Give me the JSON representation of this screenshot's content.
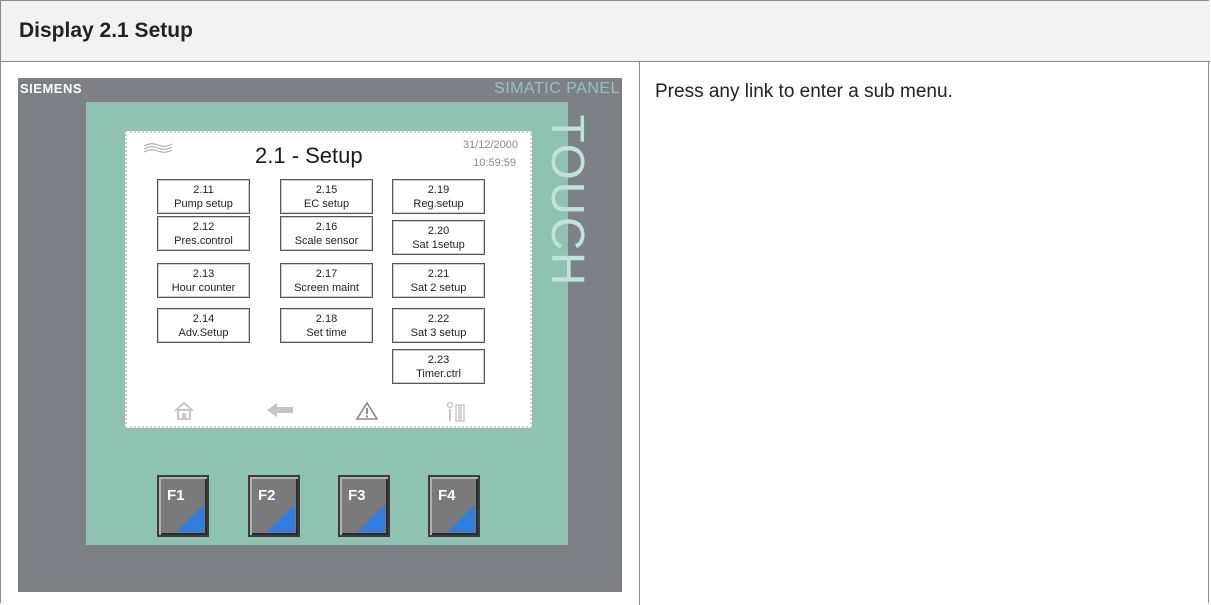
{
  "header": {
    "title": "Display 2.1 Setup"
  },
  "description": "Press any link to enter a sub menu.",
  "panel": {
    "brand": "SIEMENS",
    "model": "SIMATIC PANEL",
    "touch": "TOUCH",
    "screen": {
      "title": "2.1 - Setup",
      "date": "31/12/2000",
      "time": "10:59:59",
      "buttons": [
        {
          "num": "2.11",
          "label": "Pump setup"
        },
        {
          "num": "2.12",
          "label": "Pres.control"
        },
        {
          "num": "2.13",
          "label": "Hour counter"
        },
        {
          "num": "2.14",
          "label": "Adv.Setup"
        },
        {
          "num": "2.15",
          "label": "EC setup"
        },
        {
          "num": "2.16",
          "label": "Scale sensor"
        },
        {
          "num": "2.17",
          "label": "Screen maint"
        },
        {
          "num": "2.18",
          "label": "Set time"
        },
        {
          "num": "2.19",
          "label": "Reg.setup"
        },
        {
          "num": "2.20",
          "label": "Sat 1setup"
        },
        {
          "num": "2.21",
          "label": "Sat 2 setup"
        },
        {
          "num": "2.22",
          "label": "Sat 3 setup"
        },
        {
          "num": "2.23",
          "label": "Timer.ctrl"
        }
      ],
      "nav_icons": [
        "home-icon",
        "back-arrow-icon",
        "warning-icon",
        "settings-icon"
      ]
    },
    "function_keys": [
      "F1",
      "F2",
      "F3",
      "F4"
    ],
    "colors": {
      "bezel": "#8fc3b1",
      "frame": "#7d8185",
      "key_accent": "#2f7ee0"
    }
  }
}
